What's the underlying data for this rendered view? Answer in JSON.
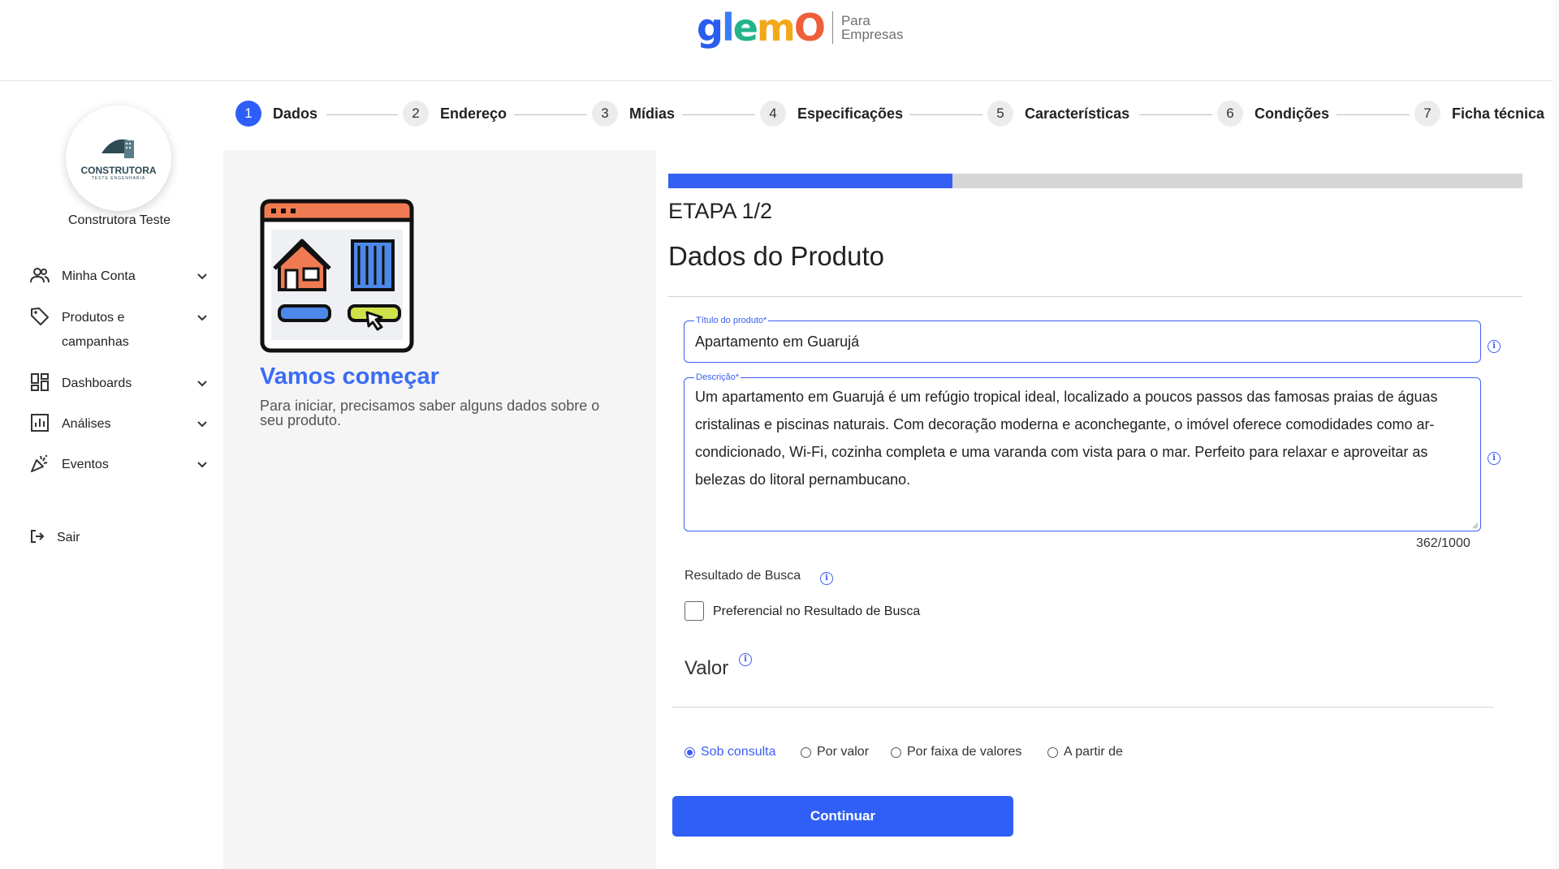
{
  "header": {
    "logo_word": "glemO",
    "logo_sub_line1": "Para",
    "logo_sub_line2": "Empresas"
  },
  "sidebar": {
    "avatar_brand": "CONSTRUTORA",
    "avatar_brand_sub": "TESTE ENGENHARIA",
    "company_name": "Construtora Teste",
    "items": [
      {
        "label": "Minha Conta",
        "icon": "users-icon"
      },
      {
        "label": "Produtos e campanhas",
        "icon": "tag-icon"
      },
      {
        "label": "Dashboards",
        "icon": "dashboard-icon"
      },
      {
        "label": "Análises",
        "icon": "chart-icon"
      },
      {
        "label": "Eventos",
        "icon": "party-icon"
      }
    ],
    "logout_label": "Sair"
  },
  "stepper": {
    "active": 1,
    "steps": [
      {
        "num": "1",
        "label": "Dados"
      },
      {
        "num": "2",
        "label": "Endereço"
      },
      {
        "num": "3",
        "label": "Mídias"
      },
      {
        "num": "4",
        "label": "Especificações"
      },
      {
        "num": "5",
        "label": "Características"
      },
      {
        "num": "6",
        "label": "Condições"
      },
      {
        "num": "7",
        "label": "Ficha técnica"
      }
    ]
  },
  "intro": {
    "title": "Vamos começar",
    "text": "Para iniciar, precisamos saber alguns dados sobre o seu produto."
  },
  "form": {
    "progress": 0.333,
    "etapa": "ETAPA 1/2",
    "title": "Dados do Produto",
    "titulo_label": "Título do produto*",
    "titulo_value": "Apartamento em Guarujá",
    "descricao_label": "Descrição*",
    "descricao_value": "Um apartamento em Guarujá é um refúgio tropical ideal, localizado a poucos passos das famosas praias de águas cristalinas e piscinas naturais. Com decoração moderna e aconchegante, o imóvel oferece comodidades como ar-condicionado, Wi-Fi, cozinha completa e uma varanda com vista para o mar. Perfeito para relaxar e aproveitar as belezas do litoral pernambucano.",
    "counter": "362/1000",
    "resultado_label": "Resultado de Busca",
    "preferencial_label": "Preferencial no Resultado de Busca",
    "preferencial_checked": false,
    "valor_label": "Valor",
    "price_options": [
      {
        "label": "Sob consulta",
        "selected": true
      },
      {
        "label": "Por valor",
        "selected": false
      },
      {
        "label": "Por faixa de valores",
        "selected": false
      },
      {
        "label": "A partir de",
        "selected": false
      }
    ],
    "continue_label": "Continuar"
  },
  "colors": {
    "accent": "#2f5ff6",
    "accent_text": "#3b6cf6",
    "panel_bg": "#f5f5f5"
  }
}
